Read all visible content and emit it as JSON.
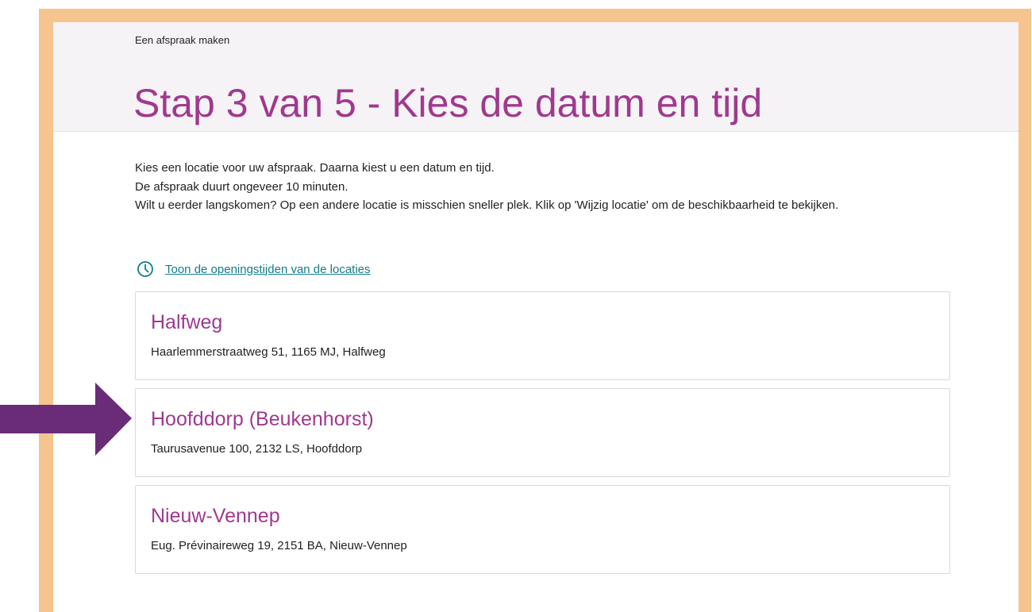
{
  "breadcrumb": "Een afspraak maken",
  "page_title": "Stap 3 van 5 - Kies de datum en tijd",
  "intro": {
    "line1": "Kies een locatie voor uw afspraak. Daarna kiest u een datum en tijd.",
    "line2": "De afspraak duurt ongeveer 10 minuten.",
    "line3": "Wilt u eerder langskomen? Op een andere locatie is misschien sneller plek. Klik op 'Wijzig locatie' om de beschikbaarheid te bekijken."
  },
  "opening_hours_link": "Toon de openingstijden van de locaties",
  "locations": [
    {
      "name": "Halfweg",
      "address": "Haarlemmerstraatweg 51, 1165 MJ, Halfweg"
    },
    {
      "name": "Hoofddorp (Beukenhorst)",
      "address": "Taurusavenue 100, 2132 LS, Hoofddorp"
    },
    {
      "name": "Nieuw-Vennep",
      "address": "Eug. Prévinaireweg 19, 2151 BA, Nieuw-Vennep"
    }
  ],
  "colors": {
    "frame": "#f5c48f",
    "heading": "#a0398e",
    "link": "#127c8a",
    "arrow": "#6a2c78"
  },
  "icons": {
    "opening_hours": "clock-icon",
    "annotation": "right-arrow-icon"
  }
}
